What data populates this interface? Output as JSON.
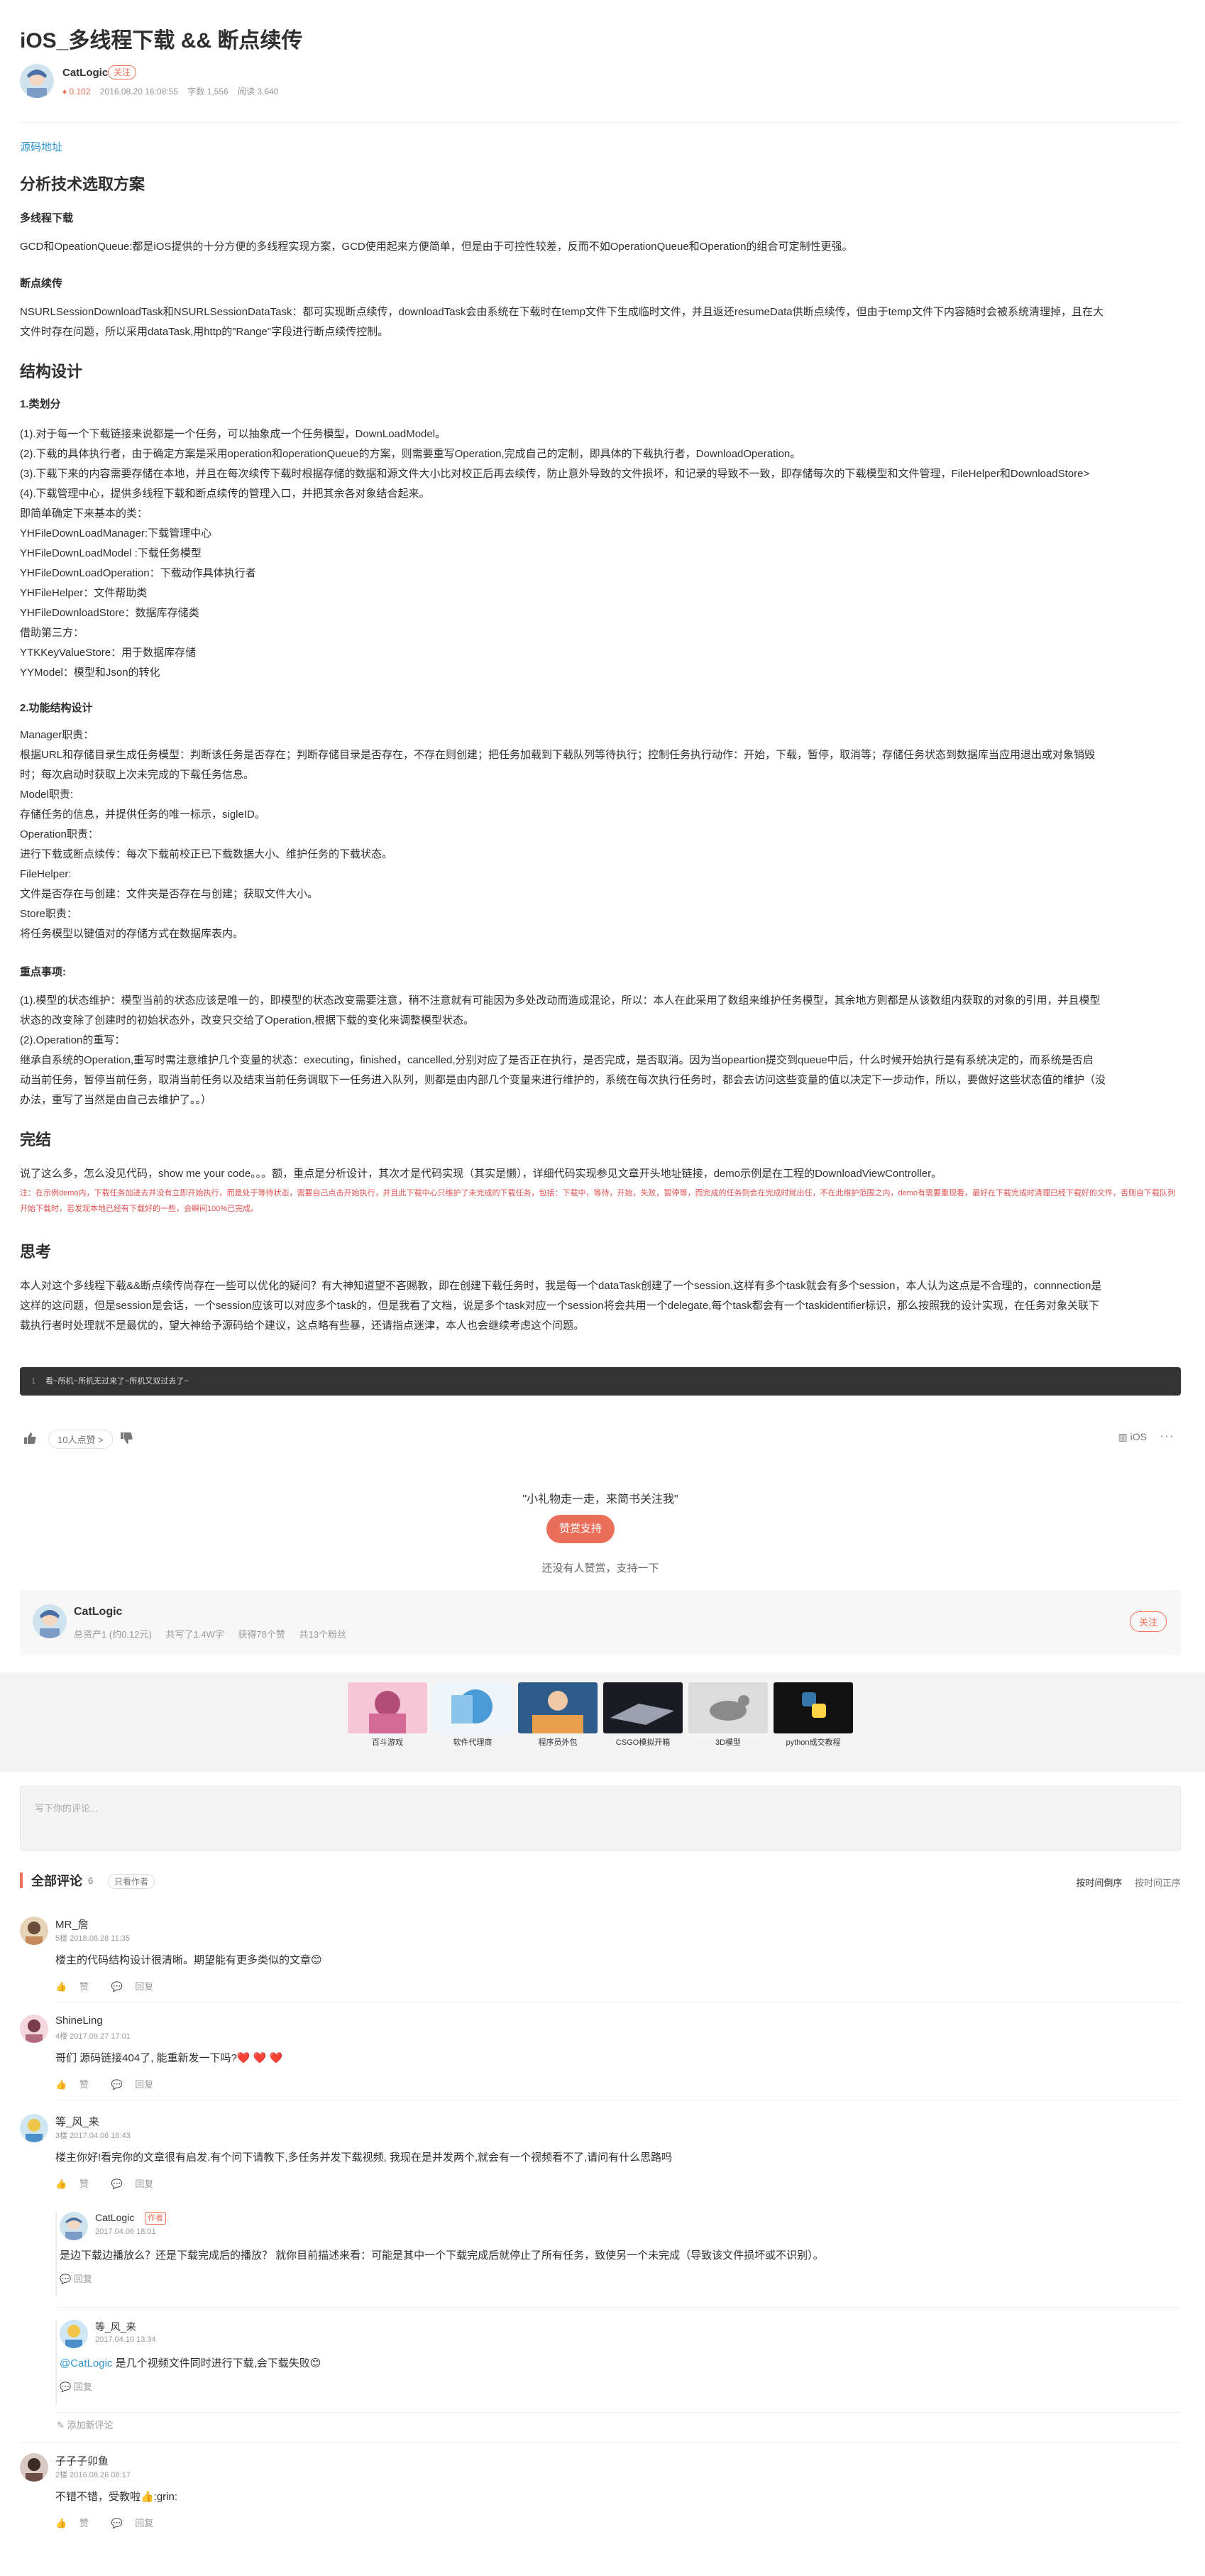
{
  "article": {
    "title": "iOS_多线程下载 && 断点续传",
    "author": "CatLogic",
    "follow": "关注",
    "diamond": "♦ 0.102",
    "date": "2016.08.20 16:08:55",
    "words": "字数 1,556",
    "reads": "阅读 3,640",
    "source_link": "源码地址",
    "h_analysis": "分析技术选取方案",
    "h_multi": "多线程下载",
    "p_multi": "GCD和OpeationQueue:都是iOS提供的十分方便的多线程实现方案，GCD使用起来方便简单，但是由于可控性较差，反而不如OperationQueue和Operation的组合可定制性更强。",
    "h_resume": "断点续传",
    "p_resume_1": "NSURLSessionDownloadTask和NSURLSessionDataTask：都可实现断点续传，downloadTask会由系统在下载时在temp文件下生成临时文件，并且返还resumeData供断点续传，但由于temp文件下内容随时会被系统清理掉，且在大",
    "p_resume_2": "文件时存在问题，所以采用dataTask,用http的\"Range\"字段进行断点续传控制。",
    "h_structure": "结构设计",
    "h_classes": "1.类划分",
    "classes_lines": [
      "(1).对于每一个下载链接来说都是一个任务，可以抽象成一个任务模型，DownLoadModel。",
      "(2).下载的具体执行者，由于确定方案是采用operation和operationQueue的方案，则需要重写Operation,完成自己的定制，即具体的下载执行者，DownloadOperation。",
      "(3).下载下来的内容需要存储在本地，并且在每次续传下载时根据存储的数据和源文件大小比对校正后再去续传，防止意外导致的文件损坏，和记录的导致不一致，即存储每次的下载模型和文件管理，FileHelper和DownloadStore>",
      "(4).下载管理中心，提供多线程下载和断点续传的管理入口，并把其余各对象结合起来。",
      "即简单确定下来基本的类：",
      "YHFileDownLoadManager:下载管理中心",
      "YHFileDownLoadModel :下载任务模型",
      "YHFileDownLoadOperation：下载动作具体执行者",
      "YHFileHelper：文件帮助类",
      "YHFileDownloadStore：数据库存储类",
      "借助第三方：",
      "YTKKeyValueStore：用于数据库存储",
      "YYModel：模型和Json的转化"
    ],
    "h_func": "2.功能结构设计",
    "func_lines": [
      "Manager职责：",
      "根据URL和存储目录生成任务模型：判断该任务是否存在；判断存储目录是否存在，不存在则创建；把任务加载到下载队列等待执行；控制任务执行动作：开始，下载，暂停，取消等；存储任务状态到数据库当应用退出或对象销毁",
      "时；每次启动时获取上次未完成的下载任务信息。",
      "Model职责:",
      "存储任务的信息，并提供任务的唯一标示，sigleID。",
      "Operation职责：",
      "进行下载或断点续传：每次下载前校正已下载数据大小、维护任务的下载状态。",
      "FileHelper:",
      "文件是否存在与创建：文件夹是否存在与创建；获取文件大小。",
      "Store职责：",
      "将任务模型以键值对的存储方式在数据库表内。"
    ],
    "h_points": "重点事项:",
    "points_lines": [
      "(1).模型的状态维护：模型当前的状态应该是唯一的，即模型的状态改变需要注意，稍不注意就有可能因为多处改动而造成混论，所以：本人在此采用了数组来维护任务模型，其余地方则都是从该数组内获取的对象的引用，并且模型",
      "状态的改变除了创建时的初始状态外，改变只交给了Operation,根据下载的变化来调整模型状态。",
      "(2).Operation的重写：",
      "继承自系统的Operation,重写时需注意维护几个变量的状态：executing，finished，cancelled,分别对应了是否正在执行，是否完成，是否取消。因为当opeartion提交到queue中后，什么时候开始执行是有系统决定的，而系统是否启",
      "动当前任务，暂停当前任务，取消当前任务以及结束当前任务调取下一任务进入队列，则都是由内部几个变量来进行维护的，系统在每次执行任务时，都会去访问这些变量的值以决定下一步动作，所以，要做好这些状态值的维护（没",
      "办法，重写了当然是由自己去维护了。。）"
    ],
    "h_done": "完结",
    "p_done": "说了这么多，怎么没见代码，show me your code。。。额，重点是分析设计，其次才是代码实现（其实是懒），详细代码实现参见文章开头地址链接，demo示例是在工程的DownloadViewController。",
    "note": "注：在示例demo内，下载任务加进去并没有立即开始执行，而是处于等待状态，需要自己点击开始执行，并且此下载中心只维护了未完成的下载任务，包括：下载中，等待，开始，失败，暂停等，而完成的任务则会在完成时就出任，不在此维护范围之内，demo有需要重现看，最好在下载完成时清理已经下载好的文件，否则自下载队列开始下载时，若发现本地已经有下载好的一些，会瞬间100%已完成。",
    "h_think": "思考",
    "think_lines": [
      "本人对这个多线程下载&&断点续传尚存在一些可以优化的疑问？有大神知道望不吝赐教，即在创建下载任务时，我是每一个dataTask创建了一个session,这样有多个task就会有多个session，本人认为这点是不合理的，connnection是",
      "这样的这问题，但是session是会话，一个session应该可以对应多个task的，但是我看了文档，说是多个task对应一个session将会共用一个delegate,每个task都会有一个taskidentifier标识，那么按照我的设计实现，在任务对象关联下",
      "载执行者时处理就不是最优的，望大神给予源码给个建议，这点略有些暴，还请指点迷津，本人也会继续考虑这个问题。"
    ],
    "code_line": "看~所机~所机无过来了~所机又双过去了~",
    "code_ln": "1"
  },
  "actions": {
    "like_count": "10人点赞 >",
    "tag": "iOS",
    "more": "···"
  },
  "reward": {
    "quote": "\"小礼物走一走，来简书关注我\"",
    "button": "赞赏支持",
    "sub": "还没有人赞赏，支持一下"
  },
  "author_card": {
    "name": "CatLogic",
    "assets": "总资产1 (约0.12元)",
    "wrote": "共写了1.4W字",
    "likes": "获得78个赞",
    "fans": "共13个粉丝",
    "follow": "关注"
  },
  "ads": [
    {
      "label": "百斗游戏"
    },
    {
      "label": "软件代理商"
    },
    {
      "label": "程序员外包"
    },
    {
      "label": "CSGO模拟开箱"
    },
    {
      "label": "3D模型"
    },
    {
      "label": "python成交教程"
    }
  ],
  "comment_input": {
    "placeholder": "写下你的评论..."
  },
  "comments_header": {
    "title": "全部评论",
    "count": "6",
    "only_author": "只看作者",
    "sort_desc": "按时间倒序",
    "sort_asc": "按时间正序"
  },
  "comments": [
    {
      "name": "MR_詹",
      "floor": "5楼 2018.08.28 11:35",
      "text": "楼主的代码结构设计很清晰。期望能有更多类似的文章😊",
      "like": "赞",
      "reply": "回复"
    },
    {
      "name": "ShineLing",
      "floor": "4楼 2017.09.27 17:01",
      "text": "哥们 源码链接404了, 能重新发一下吗?❤️ ❤️ ❤️",
      "like": "赞",
      "reply": "回复"
    },
    {
      "name": "等_风_来",
      "floor": "3楼 2017.04.06 16:43",
      "text": "楼主你好!看完你的文章很有启发.有个问下请教下,多任务并发下载视频, 我现在是并发两个,就会有一个视频看不了,请问有什么思路吗",
      "like": "赞",
      "reply": "回复"
    },
    {
      "name": "子子子卯鱼",
      "floor": "2楼 2016.08.26 08:17",
      "text": "不错不错，受教啦👍:grin:",
      "like": "赞",
      "reply": "回复"
    }
  ],
  "replies": [
    {
      "name": "CatLogic",
      "badge": "作者",
      "floor": "2017.04.06 18:01",
      "text": "是边下载边播放么？还是下载完成后的播放？ 就你目前描述来看：可能是其中一个下载完成后就停止了所有任务，致使另一个未完成（导致该文件损坏或不识别）。",
      "reply": "回复"
    },
    {
      "name": "等_风_来",
      "floor": "2017.04.10 13:34",
      "mention": "@CatLogic",
      "text": " 是几个视频文件同时进行下载,会下载失败😊",
      "reply": "回复"
    }
  ],
  "add_comment": "添加新评论"
}
